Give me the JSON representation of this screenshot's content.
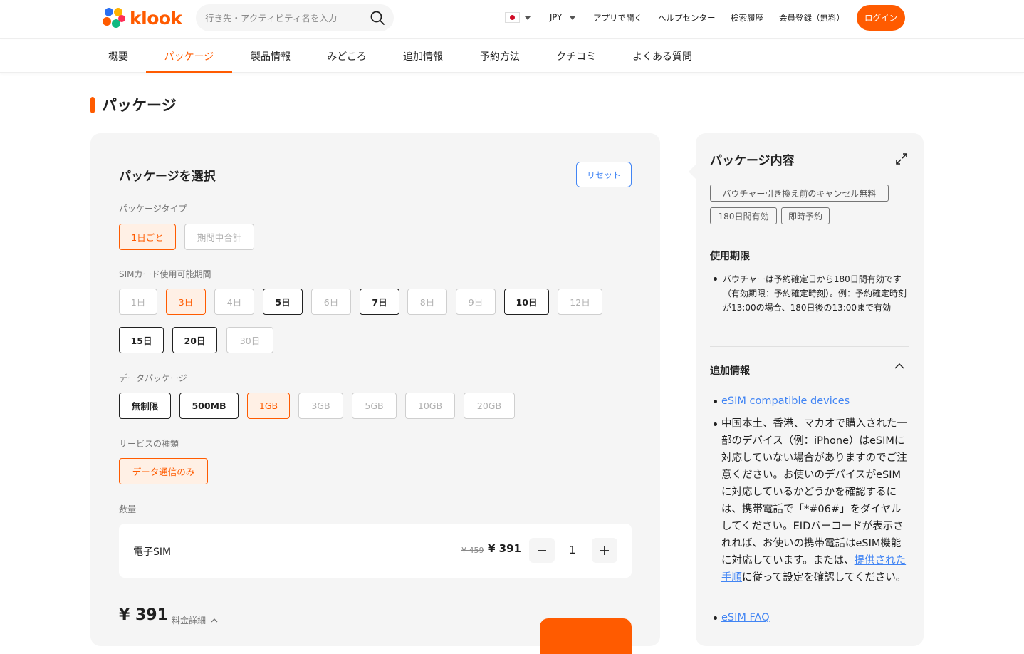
{
  "header": {
    "logo_text": "klook",
    "search_placeholder": "行き先・アクティビティ名を入力",
    "currency": "JPY",
    "links": [
      "アプリで開く",
      "ヘルプセンター",
      "検索履歴",
      "会員登録（無料）"
    ],
    "login_label": "ログイン",
    "brand_color": "#ff5b00"
  },
  "tabs": [
    "概要",
    "パッケージ",
    "製品情報",
    "みどころ",
    "追加情報",
    "予約方法",
    "クチコミ",
    "よくある質問"
  ],
  "active_tab": "パッケージ",
  "section_title": "パッケージ",
  "package": {
    "title": "パッケージを選択",
    "reset_label": "リセット",
    "type_label": "パッケージタイプ",
    "types": [
      {
        "label": "1日ごと",
        "state": "selected"
      },
      {
        "label": "期間中合計",
        "state": "disabled"
      }
    ],
    "period_label": "SIMカード使用可能期間",
    "periods": [
      {
        "label": "1日",
        "state": "disabled"
      },
      {
        "label": "3日",
        "state": "selected"
      },
      {
        "label": "4日",
        "state": "disabled"
      },
      {
        "label": "5日",
        "state": "available"
      },
      {
        "label": "6日",
        "state": "disabled"
      },
      {
        "label": "7日",
        "state": "available"
      },
      {
        "label": "8日",
        "state": "disabled"
      },
      {
        "label": "9日",
        "state": "disabled"
      },
      {
        "label": "10日",
        "state": "available"
      },
      {
        "label": "12日",
        "state": "disabled"
      },
      {
        "label": "15日",
        "state": "available"
      },
      {
        "label": "20日",
        "state": "available"
      },
      {
        "label": "30日",
        "state": "disabled"
      }
    ],
    "data_label": "データパッケージ",
    "data_options": [
      {
        "label": "無制限",
        "state": "available"
      },
      {
        "label": "500MB",
        "state": "available"
      },
      {
        "label": "1GB",
        "state": "selected"
      },
      {
        "label": "3GB",
        "state": "disabled"
      },
      {
        "label": "5GB",
        "state": "disabled"
      },
      {
        "label": "10GB",
        "state": "disabled"
      },
      {
        "label": "20GB",
        "state": "disabled"
      }
    ],
    "service_label": "サービスの種類",
    "services": [
      {
        "label": "データ通信のみ",
        "state": "selected"
      }
    ],
    "quantity_label": "数量",
    "item_name": "電子SIM",
    "old_price": "¥ 459",
    "new_price": "¥ 391",
    "quantity": "1",
    "total": "¥ 391",
    "price_detail_label": "料金詳細"
  },
  "details": {
    "title": "パッケージ内容",
    "tags": [
      "バウチャー引き換え前のキャンセル無料",
      "180日間有効",
      "即時予約"
    ],
    "validity_title": "使用期限",
    "validity_text": "バウチャーは予約確定日から180日間有効です（有効期限：予約確定時刻）。例：予約確定時刻が13:00の場合、180日後の13:00まで有効",
    "extra_title": "追加情報",
    "compat_link": "eSIM compatible devices",
    "note_text_1": "中国本土、香港、マカオで購入された一部のデバイス（例：iPhone）はeSIMに対応していない場合がありますのでご注意ください。お使いのデバイスがeSIMに対応しているかどうかを確認するには、携帯電話で「*#06#」をダイヤルしてください。EIDバーコードが表示されれば、お使いの携帯電話はeSIM機能に対応しています。または、",
    "note_link": "提供された手順",
    "note_text_2": "に従って設定を確認してください。",
    "faq_link": "eSIM FAQ"
  }
}
